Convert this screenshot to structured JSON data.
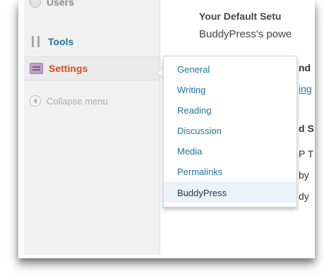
{
  "sidebar": {
    "users_label": "Users",
    "tools_label": "Tools",
    "settings_label": "Settings",
    "collapse_label": "Collapse menu"
  },
  "settings_submenu": {
    "items": [
      {
        "label": "General"
      },
      {
        "label": "Writing"
      },
      {
        "label": "Reading"
      },
      {
        "label": "Discussion"
      },
      {
        "label": "Media"
      },
      {
        "label": "Permalinks"
      },
      {
        "label": "BuddyPress"
      }
    ],
    "current": "BuddyPress"
  },
  "content": {
    "heading": "Your Default Setu",
    "paragraph": "BuddyPress's powe",
    "fragments": [
      "nd",
      "ing",
      "d S",
      "P T",
      "by",
      "dy"
    ]
  },
  "colors": {
    "link": "#21759b",
    "settings_active": "#d54e21",
    "submenu_current_bg": "#eaf2fa",
    "sidebar_bg": "#f1f1f1"
  }
}
